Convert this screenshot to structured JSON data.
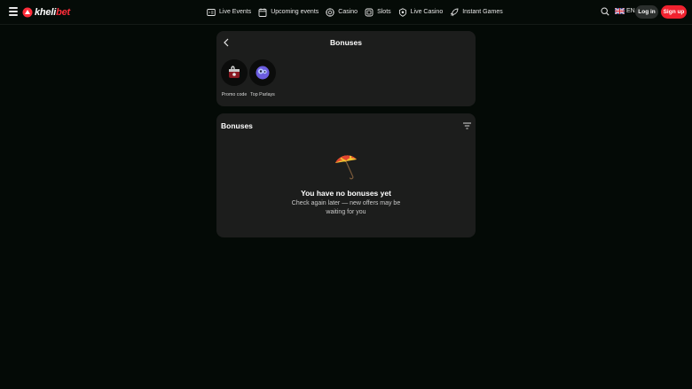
{
  "header": {
    "logo_part1": "kheli",
    "logo_part2": "bet",
    "nav": [
      {
        "label": "Live Events",
        "icon": "live-events-icon"
      },
      {
        "label": "Upcoming events",
        "icon": "calendar-icon"
      },
      {
        "label": "Casino",
        "icon": "casino-chip-icon"
      },
      {
        "label": "Slots",
        "icon": "slots-icon"
      },
      {
        "label": "Live Casino",
        "icon": "live-casino-icon"
      },
      {
        "label": "Instant Games",
        "icon": "rocket-icon"
      }
    ],
    "language": "EN",
    "login_label": "Log in",
    "signup_label": "Sign up",
    "accent_color": "#f0222f"
  },
  "bonuses_panel": {
    "title": "Bonuses",
    "tiles": [
      {
        "label": "Promo code",
        "icon": "promo-code-icon"
      },
      {
        "label": "Top Parlays",
        "icon": "top-parlays-icon"
      }
    ]
  },
  "bonuses_list": {
    "title": "Bonuses",
    "empty_icon": "umbrella-icon",
    "empty_title": "You have no bonuses yet",
    "empty_description": "Check again later — new offers may be waiting for you"
  }
}
